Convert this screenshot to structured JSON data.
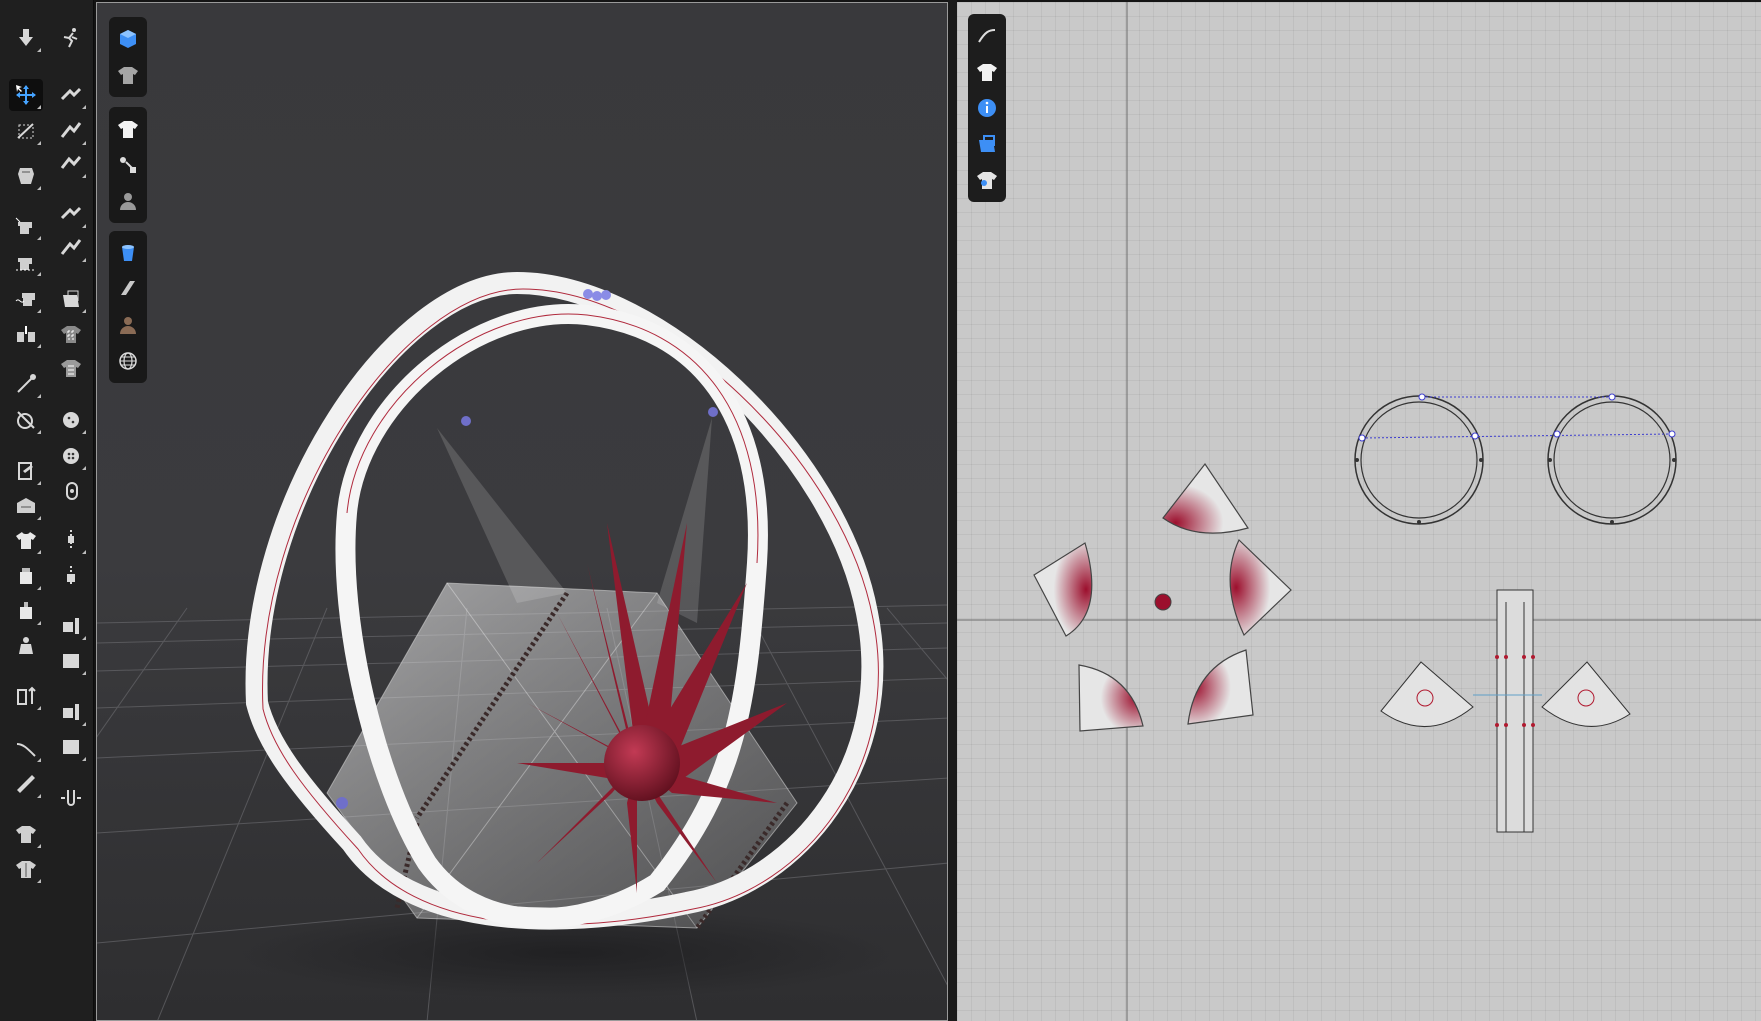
{
  "toolbar": {
    "left_column": [
      {
        "icon": "arrow-down-icon",
        "active": false
      },
      {
        "icon": "select-move-icon",
        "active": true
      },
      {
        "icon": "transform-pattern-icon",
        "active": false
      },
      {
        "icon": "fold-arrangement-icon",
        "active": false
      },
      {
        "icon": "sewing-machine-icon",
        "active": false
      },
      {
        "icon": "segment-sewing-icon",
        "active": false
      },
      {
        "icon": "free-sewing-icon",
        "active": false
      },
      {
        "icon": "tack-icon",
        "active": false
      },
      {
        "icon": "pin-icon",
        "active": false
      },
      {
        "icon": "strengthen-icon",
        "active": false
      },
      {
        "icon": "edit-texture-icon",
        "active": false
      },
      {
        "icon": "fabric-icon",
        "active": false
      },
      {
        "icon": "shirt-icon",
        "active": false
      },
      {
        "icon": "garment-layer-icon",
        "active": false
      },
      {
        "icon": "avatar-layer-icon",
        "active": false
      },
      {
        "icon": "avatar-figure-icon",
        "active": false
      },
      {
        "icon": "measure-icon",
        "active": false
      },
      {
        "icon": "tape-icon",
        "active": false
      },
      {
        "icon": "ruler-icon",
        "active": false
      },
      {
        "icon": "shirt-fit-icon",
        "active": false
      },
      {
        "icon": "shirt-stack-icon",
        "active": false
      }
    ],
    "right_column": [
      {
        "icon": "animation-icon"
      },
      {
        "icon": "puckering-icon"
      },
      {
        "icon": "line-weight-icon"
      },
      {
        "icon": "elastic-icon"
      },
      {
        "icon": "fold-icon"
      },
      {
        "icon": "bond-icon"
      },
      {
        "icon": "graphic-icon"
      },
      {
        "icon": "trim-pattern-icon"
      },
      {
        "icon": "checker-shirt-icon"
      },
      {
        "icon": "button-icon"
      },
      {
        "icon": "buttonhole-icon"
      },
      {
        "icon": "button-pin-icon"
      },
      {
        "icon": "zipper-icon"
      },
      {
        "icon": "zipper-slider-icon"
      },
      {
        "icon": "piping-icon"
      },
      {
        "icon": "piping-box-icon"
      },
      {
        "icon": "tape-box-icon"
      },
      {
        "icon": "tape-fill-icon"
      },
      {
        "icon": "hanger-icon"
      }
    ]
  },
  "viewport3d": {
    "toolbar_groups": [
      [
        "cube-icon",
        "shirt-gray-icon"
      ],
      [
        "shirt-white-icon",
        "pins-icon",
        "avatar-gray-icon"
      ],
      [
        "render-blue-icon",
        "fabric-gray-icon",
        "avatar-brown-icon",
        "globe-icon"
      ]
    ],
    "colors": {
      "background": "#3a3a3d",
      "band": "#f2f2f2",
      "flower": "#8e1b2e",
      "zipper": "#3a2a2a"
    }
  },
  "pattern2d": {
    "toolbar": [
      "pencil-icon",
      "shirt-icon",
      "info-icon",
      "export-icon",
      "garment-info-icon"
    ],
    "colors": {
      "grid": "#c9c9c9",
      "piece_fill": "#e6e6e6",
      "gradient": "#9c0f2d",
      "seam": "#3d3dcf"
    }
  }
}
